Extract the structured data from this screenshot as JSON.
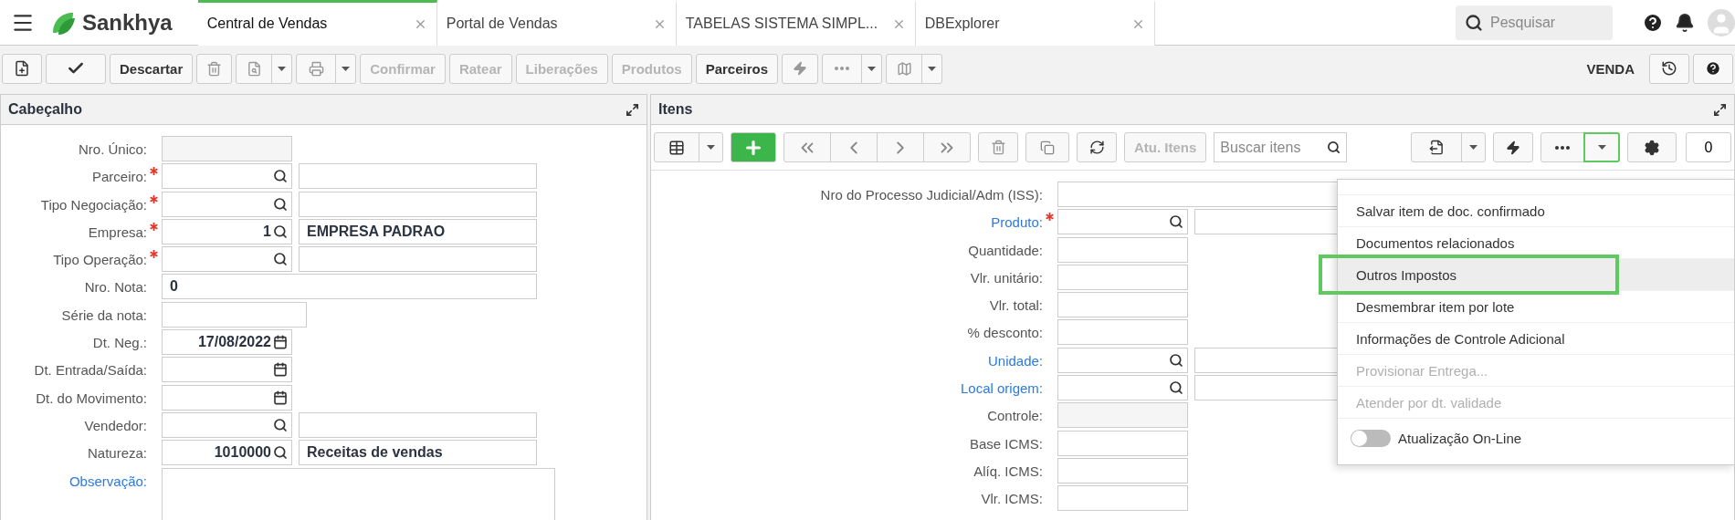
{
  "top_bar": {
    "brand": "Sankhya",
    "tabs": [
      {
        "label": "Central de Vendas",
        "selected": true
      },
      {
        "label": "Portal de Vendas",
        "selected": false
      },
      {
        "label": "TABELAS SISTEMA SIMPL...",
        "selected": false
      },
      {
        "label": "DBExplorer",
        "selected": false
      }
    ],
    "search": {
      "placeholder": "Pesquisar"
    }
  },
  "toolbar": {
    "buttons": [
      {
        "label": "Descartar",
        "disabled": false
      },
      {
        "label": "Confirmar",
        "disabled": true
      },
      {
        "label": "Ratear",
        "disabled": true
      },
      {
        "label": "Liberações",
        "disabled": true
      },
      {
        "label": "Produtos",
        "disabled": true
      },
      {
        "label": "Parceiros",
        "disabled": false
      }
    ],
    "mode": "VENDA"
  },
  "header_panel": {
    "title": "Cabeçalho",
    "fields": [
      {
        "label": "Nro. Único:",
        "kind": "readonly",
        "required": false,
        "link": false
      },
      {
        "label": "Parceiro:",
        "kind": "lookup",
        "required": true,
        "link": false
      },
      {
        "label": "Tipo Negociação:",
        "kind": "lookup",
        "required": true,
        "link": false
      },
      {
        "label": "Empresa:",
        "kind": "lookup",
        "required": true,
        "link": false,
        "value": "1",
        "description": "EMPRESA PADRAO"
      },
      {
        "label": "Tipo Operação:",
        "kind": "lookup",
        "required": true,
        "link": false
      },
      {
        "label": "Nro. Nota:",
        "kind": "wide",
        "required": false,
        "link": false,
        "value": "0"
      },
      {
        "label": "Série da nota:",
        "kind": "short",
        "required": false,
        "link": false
      },
      {
        "label": "Dt. Neg.:",
        "kind": "date",
        "required": false,
        "link": false,
        "value": "17/08/2022"
      },
      {
        "label": "Dt. Entrada/Saída:",
        "kind": "date",
        "required": false,
        "link": false
      },
      {
        "label": "Dt. do Movimento:",
        "kind": "date",
        "required": false,
        "link": false
      },
      {
        "label": "Vendedor:",
        "kind": "lookup",
        "required": false,
        "link": false
      },
      {
        "label": "Natureza:",
        "kind": "lookup",
        "required": false,
        "link": false,
        "value": "1010000",
        "description": "Receitas de vendas"
      },
      {
        "label": "Observação:",
        "kind": "textarea",
        "required": false,
        "link": true
      }
    ]
  },
  "items_panel": {
    "title": "Itens",
    "update_button": {
      "label": "Atu. Itens",
      "disabled": true
    },
    "search": {
      "placeholder": "Buscar itens"
    },
    "count": "0",
    "fields": [
      {
        "label": "Nro do Processo Judicial/Adm (ISS):",
        "kind": "wide",
        "required": false,
        "link": false
      },
      {
        "label": "Produto:",
        "kind": "lookup",
        "required": true,
        "link": true
      },
      {
        "label": "Quantidade:",
        "kind": "plain",
        "required": false,
        "link": false
      },
      {
        "label": "Vlr. unitário:",
        "kind": "plain",
        "required": false,
        "link": false
      },
      {
        "label": "Vlr. total:",
        "kind": "plain",
        "required": false,
        "link": false
      },
      {
        "label": "% desconto:",
        "kind": "plain",
        "required": false,
        "link": false
      },
      {
        "label": "Unidade:",
        "kind": "lookup",
        "required": false,
        "link": true
      },
      {
        "label": "Local origem:",
        "kind": "lookup",
        "required": false,
        "link": true
      },
      {
        "label": "Controle:",
        "kind": "readonly",
        "required": false,
        "link": false
      },
      {
        "label": "Base ICMS:",
        "kind": "plain",
        "required": false,
        "link": false
      },
      {
        "label": "Alíq. ICMS:",
        "kind": "plain",
        "required": false,
        "link": false
      },
      {
        "label": "Vlr. ICMS:",
        "kind": "plain",
        "required": false,
        "link": false
      }
    ]
  },
  "menu": {
    "open": true,
    "items": [
      {
        "kind": "item",
        "label": "Salvar item de doc. confirmado",
        "disabled": false,
        "selected": false
      },
      {
        "kind": "item",
        "label": "Documentos relacionados",
        "disabled": false,
        "selected": false
      },
      {
        "kind": "item",
        "label": "Outros Impostos",
        "disabled": false,
        "selected": true
      },
      {
        "kind": "item",
        "label": "Desmembrar item por lote",
        "disabled": false,
        "selected": false
      },
      {
        "kind": "item",
        "label": "Informações de Controle Adicional",
        "disabled": false,
        "selected": false
      },
      {
        "kind": "item",
        "label": "Provisionar Entrega...",
        "disabled": true,
        "selected": false
      },
      {
        "kind": "item",
        "label": "Atender por dt. validade",
        "disabled": true,
        "selected": false
      },
      {
        "kind": "toggle",
        "label": "Atualização On-Line",
        "on": false
      }
    ]
  }
}
